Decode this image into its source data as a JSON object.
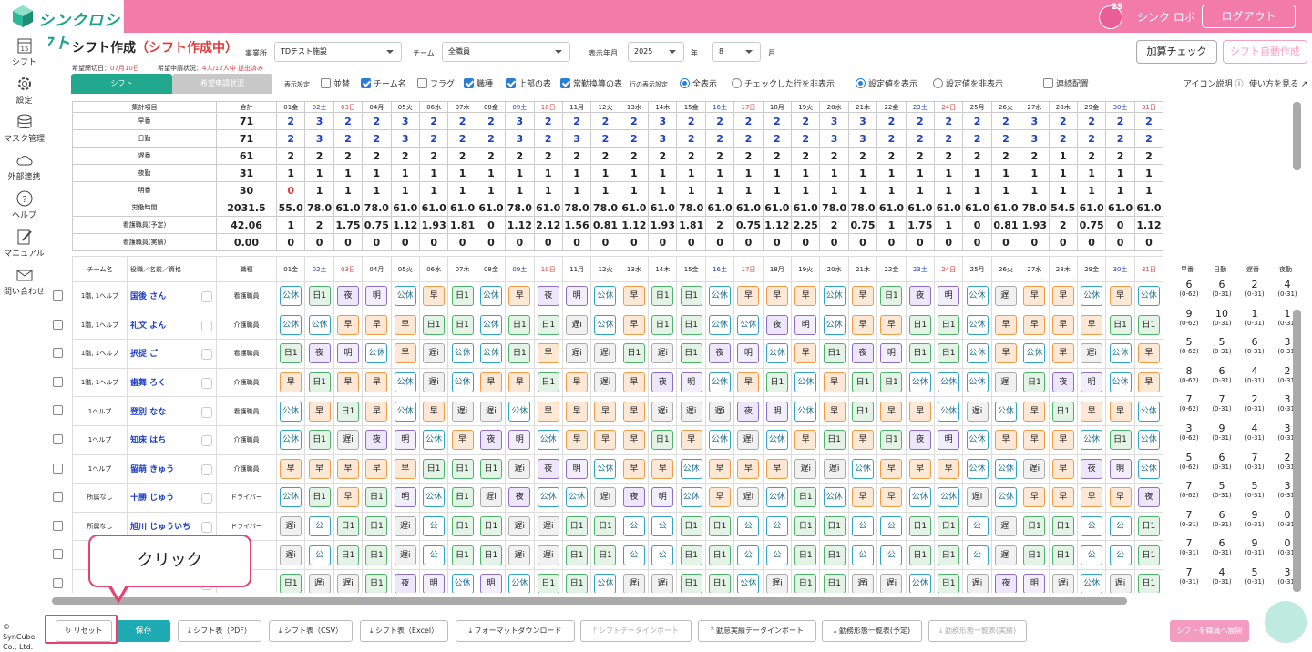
{
  "app": {
    "logo": "シンクロシフト",
    "user": "シンク ロボ",
    "logout": "ログアウト",
    "notifications": "29",
    "cal_day": "15"
  },
  "sidebar": [
    {
      "label": "シフト",
      "icon": "calendar-icon"
    },
    {
      "label": "設定",
      "icon": "gear-icon"
    },
    {
      "label": "マスタ管理",
      "icon": "database-icon"
    },
    {
      "label": "外部連携",
      "icon": "cloud-sync-icon"
    },
    {
      "label": "ヘルプ",
      "icon": "help-icon"
    },
    {
      "label": "マニュアル",
      "icon": "manual-icon"
    },
    {
      "label": "問い合わせ",
      "icon": "mail-icon"
    }
  ],
  "header": {
    "title": "シフト作成",
    "status": "（シフト作成中）",
    "office_label": "事業所",
    "office": "TDテスト施設",
    "team_label": "チーム",
    "team": "全職員",
    "ym_label": "表示年月",
    "year": "2025",
    "year_unit": "年",
    "month": "8",
    "month_unit": "月",
    "deadline_label": "希望締切日：",
    "deadline": "07月10日",
    "req_label": "希望申請状況：",
    "req": "4人/12人中 提出済み",
    "calc_btn": "加算チェック",
    "auto_btn": "シフト自動作成"
  },
  "tabs": {
    "shift": "シフト",
    "request": "希望申請状況"
  },
  "options": {
    "display_label": "表示設定",
    "sort": "並替",
    "team_name": "チーム名",
    "flag": "フラグ",
    "job": "職種",
    "upper": "上部の表",
    "fulltime": "常勤換算の表",
    "row_label": "行の表示設定",
    "show_all": "全表示",
    "hide_checked": "チェックした行を非表示",
    "show_settings": "設定値を表示",
    "hide_settings": "設定値を非表示",
    "consecutive": "連続配置",
    "icon_help": "アイコン説明",
    "how_to": "使い方を見る"
  },
  "days": [
    "01金",
    "02土",
    "03日",
    "04月",
    "05火",
    "06水",
    "07木",
    "08金",
    "09土",
    "10日",
    "11月",
    "12火",
    "13水",
    "14木",
    "15金",
    "16土",
    "17日",
    "18月",
    "19火",
    "20水",
    "21木",
    "22金",
    "23土",
    "24日",
    "25月",
    "26火",
    "27水",
    "28木",
    "29金",
    "30土",
    "31日"
  ],
  "summary": {
    "head_label": "集計項目",
    "head_total": "合計",
    "rows": [
      {
        "label": "早番",
        "total": "71",
        "v": [
          "2",
          "3",
          "2",
          "2",
          "3",
          "2",
          "2",
          "2",
          "3",
          "2",
          "2",
          "2",
          "2",
          "3",
          "2",
          "2",
          "2",
          "2",
          "2",
          "3",
          "3",
          "2",
          "2",
          "2",
          "2",
          "2",
          "3",
          "2",
          "2",
          "2",
          "2"
        ]
      },
      {
        "label": "日勤",
        "total": "71",
        "v": [
          "2",
          "3",
          "2",
          "2",
          "3",
          "2",
          "2",
          "2",
          "3",
          "2",
          "3",
          "2",
          "2",
          "3",
          "2",
          "2",
          "2",
          "2",
          "2",
          "3",
          "3",
          "2",
          "2",
          "2",
          "2",
          "2",
          "3",
          "2",
          "2",
          "2",
          "2"
        ]
      },
      {
        "label": "遅番",
        "total": "61",
        "v": [
          "2",
          "2",
          "2",
          "2",
          "2",
          "2",
          "2",
          "2",
          "2",
          "2",
          "2",
          "2",
          "2",
          "2",
          "2",
          "2",
          "2",
          "2",
          "2",
          "2",
          "2",
          "2",
          "2",
          "2",
          "2",
          "2",
          "2",
          "1",
          "2",
          "2",
          "2"
        ]
      },
      {
        "label": "夜勤",
        "total": "31",
        "v": [
          "1",
          "1",
          "1",
          "1",
          "1",
          "1",
          "1",
          "1",
          "1",
          "1",
          "1",
          "1",
          "1",
          "1",
          "1",
          "1",
          "1",
          "1",
          "1",
          "1",
          "1",
          "1",
          "1",
          "1",
          "1",
          "1",
          "1",
          "1",
          "1",
          "1",
          "1"
        ]
      },
      {
        "label": "明番",
        "total": "30",
        "v": [
          "0",
          "1",
          "1",
          "1",
          "1",
          "1",
          "1",
          "1",
          "1",
          "1",
          "1",
          "1",
          "1",
          "1",
          "1",
          "1",
          "1",
          "1",
          "1",
          "1",
          "1",
          "1",
          "1",
          "1",
          "1",
          "1",
          "1",
          "1",
          "1",
          "1",
          "1"
        ]
      },
      {
        "label": "労働時間",
        "total": "2031.5",
        "v": [
          "55.0",
          "78.0",
          "61.0",
          "78.0",
          "61.0",
          "61.0",
          "61.0",
          "61.0",
          "78.0",
          "61.0",
          "78.0",
          "78.0",
          "61.0",
          "61.0",
          "78.0",
          "61.0",
          "61.0",
          "61.0",
          "61.0",
          "78.0",
          "78.0",
          "61.0",
          "61.0",
          "61.0",
          "61.0",
          "61.0",
          "78.0",
          "54.5",
          "61.0",
          "61.0",
          "61.0"
        ]
      },
      {
        "label": "看護職員(予定)",
        "total": "42.06",
        "v": [
          "1",
          "2",
          "1.75",
          "0.75",
          "1.12",
          "1.93",
          "1.81",
          "0",
          "1.12",
          "2.12",
          "1.56",
          "0.81",
          "1.12",
          "1.93",
          "1.81",
          "2",
          "0.75",
          "1.12",
          "2.25",
          "2",
          "0.75",
          "1",
          "1.75",
          "1",
          "0",
          "0.81",
          "1.93",
          "2",
          "0.75",
          "0",
          "1.12"
        ]
      },
      {
        "label": "看護職員(実績)",
        "total": "0.00",
        "v": [
          "0",
          "0",
          "0",
          "0",
          "0",
          "0",
          "0",
          "0",
          "0",
          "0",
          "0",
          "0",
          "0",
          "0",
          "0",
          "0",
          "0",
          "0",
          "0",
          "0",
          "0",
          "0",
          "0",
          "0",
          "0",
          "0",
          "0",
          "0",
          "0",
          "0",
          "0"
        ]
      }
    ]
  },
  "grid": {
    "h_team": "チーム名",
    "h_name": "役職／名前／資格",
    "h_job": "職種",
    "rows": [
      {
        "team": "1階, 1ヘルプ",
        "name": "国後 さん",
        "job": "看護職員",
        "s": [
          "公休",
          "日1",
          "夜",
          "明",
          "公休",
          "早",
          "日1",
          "公休",
          "早",
          "夜",
          "明",
          "公休",
          "早",
          "日1",
          "日1",
          "公休",
          "早",
          "早",
          "早",
          "公休",
          "早",
          "日1",
          "夜",
          "明",
          "公休",
          "遅i",
          "早",
          "早",
          "公休",
          "早",
          "公休"
        ]
      },
      {
        "team": "1階, 1ヘルプ",
        "name": "礼文 よん",
        "job": "介護職員",
        "s": [
          "公休",
          "公休",
          "早",
          "早",
          "早",
          "日1",
          "日1",
          "公休",
          "日1",
          "日1",
          "遅i",
          "公休",
          "早",
          "日1",
          "日1",
          "公休",
          "公休",
          "夜",
          "明",
          "公休",
          "早",
          "早",
          "日1",
          "日1",
          "公休",
          "早",
          "早",
          "早",
          "早",
          "日1",
          "日1"
        ]
      },
      {
        "team": "1階, 1ヘルプ",
        "name": "択捉 ご",
        "job": "看護職員",
        "s": [
          "日1",
          "夜",
          "明",
          "公休",
          "早",
          "遅i",
          "公休",
          "公休",
          "日1",
          "早",
          "遅i",
          "遅i",
          "日1",
          "遅i",
          "日1",
          "夜",
          "明",
          "公休",
          "早",
          "日1",
          "夜",
          "明",
          "日1",
          "日1",
          "公休",
          "早",
          "公休",
          "早",
          "遅i",
          "公休",
          "早"
        ]
      },
      {
        "team": "1階, 1ヘルプ",
        "name": "歯舞 ろく",
        "job": "介護職員",
        "s": [
          "早",
          "日1",
          "早",
          "早",
          "公休",
          "遅i",
          "公休",
          "早",
          "早",
          "日1",
          "早",
          "遅i",
          "早",
          "夜",
          "明",
          "公休",
          "早",
          "日1",
          "公休",
          "早",
          "日1",
          "日1",
          "公休",
          "公休",
          "公休",
          "遅i",
          "日1",
          "夜",
          "明",
          "公休",
          "早"
        ]
      },
      {
        "team": "1ヘルプ",
        "name": "登別 なな",
        "job": "看護職員",
        "s": [
          "公休",
          "早",
          "日1",
          "早",
          "公休",
          "早",
          "遅i",
          "遅i",
          "公休",
          "早",
          "早",
          "早",
          "早",
          "遅i",
          "遅i",
          "遅i",
          "夜",
          "明",
          "公休",
          "早",
          "日1",
          "早",
          "早",
          "公休",
          "遅i",
          "公休",
          "早",
          "日1",
          "早",
          "早",
          "公休"
        ]
      },
      {
        "team": "1ヘルプ",
        "name": "知床 はち",
        "job": "介護職員",
        "s": [
          "公休",
          "日1",
          "遅i",
          "夜",
          "明",
          "公休",
          "早",
          "夜",
          "明",
          "公休",
          "早",
          "早",
          "早",
          "日1",
          "早",
          "公休",
          "遅i",
          "公休",
          "早",
          "日1",
          "早",
          "日1",
          "夜",
          "明",
          "公休",
          "早",
          "早",
          "早",
          "公休",
          "日1",
          "公休"
        ]
      },
      {
        "team": "1ヘルプ",
        "name": "留萌 きゅう",
        "job": "介護職員",
        "s": [
          "早",
          "早",
          "早",
          "早",
          "早",
          "日1",
          "日1",
          "日1",
          "遅i",
          "夜",
          "明",
          "公休",
          "早",
          "早",
          "公休",
          "早",
          "早",
          "早",
          "遅i",
          "遅i",
          "公休",
          "早",
          "早",
          "早",
          "公休",
          "公休",
          "遅i",
          "早",
          "夜",
          "明",
          "公休"
        ]
      },
      {
        "team": "所属なし",
        "name": "十勝 じゅう",
        "job": "ドライバー",
        "s": [
          "公休",
          "日1",
          "早",
          "日1",
          "明",
          "公休",
          "日1",
          "遅i",
          "夜",
          "公休",
          "公休",
          "遅i",
          "夜",
          "明",
          "公休",
          "早",
          "遅i",
          "公休",
          "日1",
          "公休",
          "早",
          "早",
          "公休",
          "公休",
          "遅i",
          "公休",
          "早",
          "早",
          "早",
          "早",
          "夜"
        ]
      },
      {
        "team": "所属なし",
        "name": "旭川 じゅういち",
        "job": "ドライバー",
        "s": [
          "遅i",
          "公",
          "日1",
          "日1",
          "遅i",
          "公",
          "日1",
          "日1",
          "遅i",
          "遅i",
          "日1",
          "日1",
          "公",
          "公",
          "日1",
          "日1",
          "公",
          "公",
          "日1",
          "日1",
          "公",
          "公",
          "日1",
          "日1",
          "公",
          "遅i",
          "日1",
          "日1",
          "公",
          "公",
          "日1"
        ]
      },
      {
        "team": "",
        "name": "",
        "job": "",
        "s": [
          "遅i",
          "公",
          "日1",
          "日1",
          "遅i",
          "公",
          "日1",
          "日1",
          "遅i",
          "遅i",
          "日1",
          "日1",
          "公",
          "公",
          "日1",
          "日1",
          "公",
          "公",
          "日1",
          "日1",
          "公",
          "公",
          "日1",
          "日1",
          "公",
          "遅i",
          "日1",
          "日1",
          "公",
          "公",
          "日1"
        ]
      },
      {
        "team": "",
        "name": "",
        "job": "",
        "s": [
          "日1",
          "遅i",
          "遅i",
          "日1",
          "夜",
          "明",
          "公休",
          "明",
          "公休",
          "日1",
          "日1",
          "公休",
          "遅i",
          "遅i",
          "日1",
          "日1",
          "公休",
          "遅i",
          "日1",
          "日1",
          "遅i",
          "遅i",
          "公休",
          "日1",
          "遅i",
          "夜",
          "明",
          "遅i",
          "公休",
          "遅i",
          "日1"
        ]
      }
    ]
  },
  "stats": {
    "heads": [
      "早番",
      "日勤",
      "遅番",
      "夜勤"
    ],
    "rows": [
      [
        "6",
        "(0-62)",
        "6",
        "(0-31)",
        "2",
        "(0-31)",
        "4",
        "(0-31)"
      ],
      [
        "9",
        "(0-62)",
        "10",
        "(0-31)",
        "1",
        "(0-31)",
        "1",
        "(0-31)"
      ],
      [
        "5",
        "(0-62)",
        "5",
        "(0-31)",
        "6",
        "(0-31)",
        "3",
        "(0-31)"
      ],
      [
        "8",
        "(0-62)",
        "6",
        "(0-31)",
        "4",
        "(0-31)",
        "2",
        "(0-31)"
      ],
      [
        "7",
        "(0-62)",
        "7",
        "(0-31)",
        "2",
        "(0-31)",
        "3",
        "(0-31)"
      ],
      [
        "3",
        "(0-62)",
        "9",
        "(0-31)",
        "4",
        "(0-31)",
        "3",
        "(0-31)"
      ],
      [
        "5",
        "(0-62)",
        "6",
        "(0-31)",
        "7",
        "(0-31)",
        "2",
        "(0-31)"
      ],
      [
        "7",
        "(0-62)",
        "5",
        "(0-31)",
        "5",
        "(0-31)",
        "3",
        "(0-31)"
      ],
      [
        "7",
        "(0-31)",
        "6",
        "(0-31)",
        "9",
        "(0-31)",
        "0",
        "(0-31)"
      ],
      [
        "7",
        "(0-31)",
        "6",
        "(0-31)",
        "9",
        "(0-31)",
        "0",
        "(0-31)"
      ],
      [
        "7",
        "(0-31)",
        "4",
        "(0-31)",
        "5",
        "(0-31)",
        "3",
        "(0-31)"
      ]
    ]
  },
  "footer": {
    "copyright": "© SynCube Co., Ltd.",
    "reset": "リセット",
    "save": "保存",
    "pdf": "シフト表（PDF）",
    "csv": "シフト表（CSV）",
    "excel": "シフト表（Excel）",
    "format": "フォーマットダウンロード",
    "import": "シフトデータインポート",
    "attend_import": "勤怠実績データインポート",
    "list_plan": "勤務形態一覧表(予定)",
    "list_actual": "勤務形態一覧表(実績)",
    "expand": "シフトを職員へ展開"
  },
  "callout": "クリック"
}
